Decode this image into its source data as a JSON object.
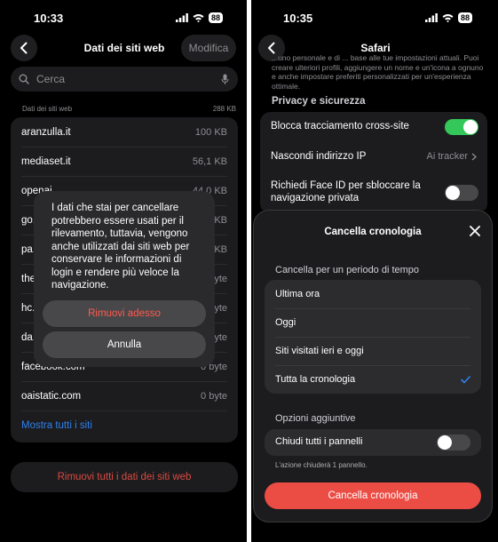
{
  "left": {
    "status": {
      "time": "10:33",
      "battery": "88"
    },
    "nav": {
      "title": "Dati dei siti web",
      "edit": "Modifica"
    },
    "search": {
      "placeholder": "Cerca"
    },
    "section": {
      "label": "Dati dei siti web",
      "total": "288 KB"
    },
    "sites": [
      {
        "name": "aranzulla.it",
        "size": "100 KB"
      },
      {
        "name": "mediaset.it",
        "size": "56,1 KB"
      },
      {
        "name": "openai...",
        "size": "44,0 KB"
      },
      {
        "name": "go...",
        "size": "...KB"
      },
      {
        "name": "pa...",
        "size": "...KB"
      },
      {
        "name": "the...",
        "size": "...byte"
      },
      {
        "name": "hc...",
        "size": "...byte"
      },
      {
        "name": "da...",
        "size": "...byte"
      },
      {
        "name": "facebook.com",
        "size": "0 byte"
      },
      {
        "name": "oaistatic.com",
        "size": "0 byte"
      }
    ],
    "show_all": "Mostra tutti i siti",
    "remove_all": "Rimuovi tutti i dati dei siti web",
    "alert": {
      "message": "I dati che stai per cancellare potrebbero essere usati per il rilevamento, tuttavia, vengono anche utilizzati dai siti web per conservare le informazioni di login e rendere più veloce la navigazione.",
      "remove": "Rimuovi adesso",
      "cancel": "Annulla"
    }
  },
  "right": {
    "status": {
      "time": "10:35",
      "battery": "88"
    },
    "nav": {
      "title": "Safari"
    },
    "intro": "...uno personale e di ... base alle tue impostazioni attuali. Puoi creare ulteriori profili, aggiungere un nome e un'icona a ognuno e anche impostare preferiti personalizzati per un'esperienza ottimale.",
    "privacy": {
      "header": "Privacy e sicurezza",
      "block_tracking": "Blocca tracciamento cross-site",
      "hide_ip": "Nascondi indirizzo IP",
      "hide_ip_value": "Ai tracker",
      "face_id": "Richiedi Face ID per sbloccare la navigazione privata"
    },
    "sheet": {
      "title": "Cancella cronologia",
      "period_header": "Cancella per un periodo di tempo",
      "options": [
        "Ultima ora",
        "Oggi",
        "Siti visitati ieri e oggi",
        "Tutta la cronologia"
      ],
      "selected_index": 3,
      "extra_header": "Opzioni aggiuntive",
      "close_tabs": "Chiudi tutti i pannelli",
      "close_tabs_note": "L'azione chiuderà 1 pannello.",
      "confirm": "Cancella cronologia"
    },
    "colors": {
      "accent": "#2f80ed",
      "toggle_on": "#34c759",
      "destructive": "#eb4d45"
    }
  }
}
